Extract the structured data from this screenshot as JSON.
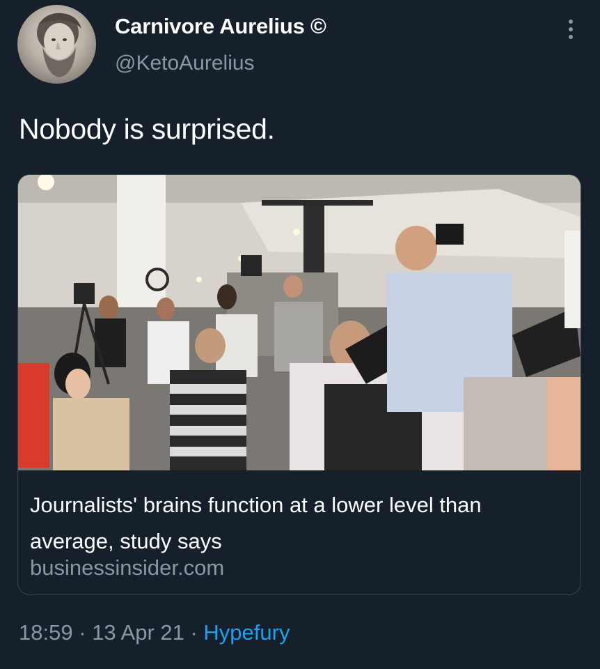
{
  "author": {
    "display_name": "Carnivore Aurelius ©",
    "handle": "@KetoAurelius",
    "avatar_icon": "marcus-aurelius-bust-avatar"
  },
  "tweet": {
    "text": "Nobody is surprised."
  },
  "card": {
    "image_icon": "press-photographers-photo",
    "title": "Journalists' brains function at a lower level than average, study says",
    "domain": "businessinsider.com"
  },
  "meta": {
    "time": "18:59",
    "separator": " · ",
    "date": "13 Apr 21",
    "source": "Hypefury"
  },
  "colors": {
    "background": "#15202b",
    "secondary_text": "#8899a6",
    "link": "#1da1f2",
    "border": "#38444d"
  }
}
